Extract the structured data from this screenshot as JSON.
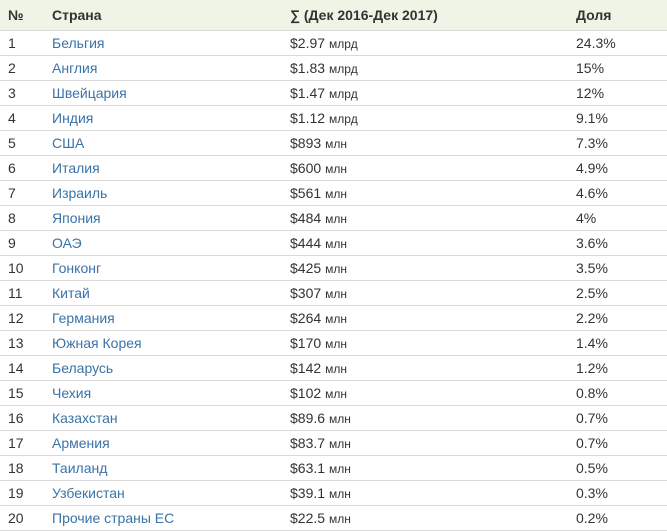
{
  "table": {
    "headers": [
      "№",
      "Страна",
      "∑ (Дек 2016-Дек 2017)",
      "Доля"
    ],
    "rows": [
      {
        "num": "1",
        "country": "Бельгия",
        "amount": "$2.97",
        "unit": "млрд",
        "share": "24.3%"
      },
      {
        "num": "2",
        "country": "Англия",
        "amount": "$1.83",
        "unit": "млрд",
        "share": "15%"
      },
      {
        "num": "3",
        "country": "Швейцария",
        "amount": "$1.47",
        "unit": "млрд",
        "share": "12%"
      },
      {
        "num": "4",
        "country": "Индия",
        "amount": "$1.12",
        "unit": "млрд",
        "share": "9.1%"
      },
      {
        "num": "5",
        "country": "США",
        "amount": "$893",
        "unit": "млн",
        "share": "7.3%"
      },
      {
        "num": "6",
        "country": "Италия",
        "amount": "$600",
        "unit": "млн",
        "share": "4.9%"
      },
      {
        "num": "7",
        "country": "Израиль",
        "amount": "$561",
        "unit": "млн",
        "share": "4.6%"
      },
      {
        "num": "8",
        "country": "Япония",
        "amount": "$484",
        "unit": "млн",
        "share": "4%"
      },
      {
        "num": "9",
        "country": "ОАЭ",
        "amount": "$444",
        "unit": "млн",
        "share": "3.6%"
      },
      {
        "num": "10",
        "country": "Гонконг",
        "amount": "$425",
        "unit": "млн",
        "share": "3.5%"
      },
      {
        "num": "11",
        "country": "Китай",
        "amount": "$307",
        "unit": "млн",
        "share": "2.5%"
      },
      {
        "num": "12",
        "country": "Германия",
        "amount": "$264",
        "unit": "млн",
        "share": "2.2%"
      },
      {
        "num": "13",
        "country": "Южная Корея",
        "amount": "$170",
        "unit": "млн",
        "share": "1.4%"
      },
      {
        "num": "14",
        "country": "Беларусь",
        "amount": "$142",
        "unit": "млн",
        "share": "1.2%"
      },
      {
        "num": "15",
        "country": "Чехия",
        "amount": "$102",
        "unit": "млн",
        "share": "0.8%"
      },
      {
        "num": "16",
        "country": "Казахстан",
        "amount": "$89.6",
        "unit": "млн",
        "share": "0.7%"
      },
      {
        "num": "17",
        "country": "Армения",
        "amount": "$83.7",
        "unit": "млн",
        "share": "0.7%"
      },
      {
        "num": "18",
        "country": "Таиланд",
        "amount": "$63.1",
        "unit": "млн",
        "share": "0.5%"
      },
      {
        "num": "19",
        "country": "Узбекистан",
        "amount": "$39.1",
        "unit": "млн",
        "share": "0.3%"
      },
      {
        "num": "20",
        "country": "Прочие страны ЕС",
        "amount": "$22.5",
        "unit": "млн",
        "share": "0.2%"
      }
    ]
  },
  "colors": {
    "header_bg": "#eef5e6",
    "link": "#3a73a8",
    "text": "#333333",
    "divider": "#d9d9d9"
  }
}
